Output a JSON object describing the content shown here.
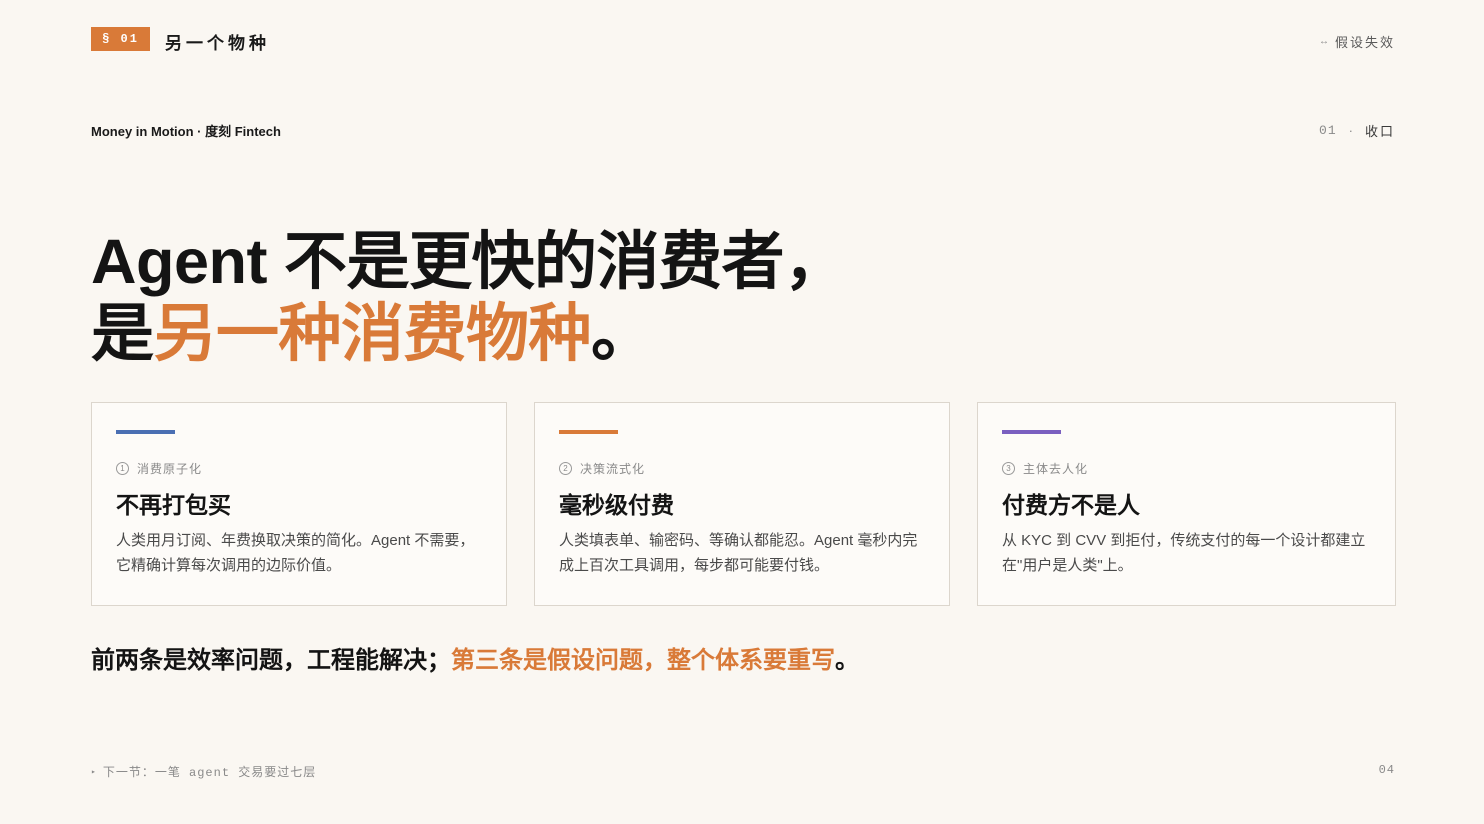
{
  "header": {
    "section_badge": "§ 01",
    "section_title": "另一个物种",
    "status_icon": "arrow-icon",
    "status_glyph": "↔",
    "status_label": "假设失效"
  },
  "subheader": {
    "brand": "Money in Motion · 度刻 Fintech",
    "page_number": "01",
    "separator": "·",
    "page_label": "收口"
  },
  "headline": {
    "line1": "Agent 不是更快的消费者，",
    "line2_prefix": "是",
    "line2_accent": "另一种消费物种",
    "line2_suffix": "。"
  },
  "cards": [
    {
      "number": "1",
      "kicker": "消费原子化",
      "title": "不再打包买",
      "desc": "人类用月订阅、年费换取决策的简化。Agent 不需要，它精确计算每次调用的边际价值。",
      "bar_color": "#4A6FB3"
    },
    {
      "number": "2",
      "kicker": "决策流式化",
      "title": "毫秒级付费",
      "desc": "人类填表单、输密码、等确认都能忍。Agent 毫秒内完成上百次工具调用，每步都可能要付钱。",
      "bar_color": "#D97A38"
    },
    {
      "number": "3",
      "kicker": "主体去人化",
      "title": "付费方不是人",
      "desc": "从 KYC 到 CVV 到拒付，传统支付的每一个设计都建立在\"用户是人类\"上。",
      "bar_color": "#7A5FC0"
    }
  ],
  "conclusion": {
    "prefix": "前两条是效率问题，工程能解决；",
    "accent": "第三条是假设问题，整个体系要重写",
    "suffix": "。"
  },
  "footer": {
    "next_icon": "triangle-right-icon",
    "next_glyph": "▸",
    "next_label": "下一节：一笔 agent 交易要过七层",
    "page": "04"
  },
  "colors": {
    "accent": "#D97A38",
    "background": "#FAF7F2",
    "text": "#141414"
  }
}
